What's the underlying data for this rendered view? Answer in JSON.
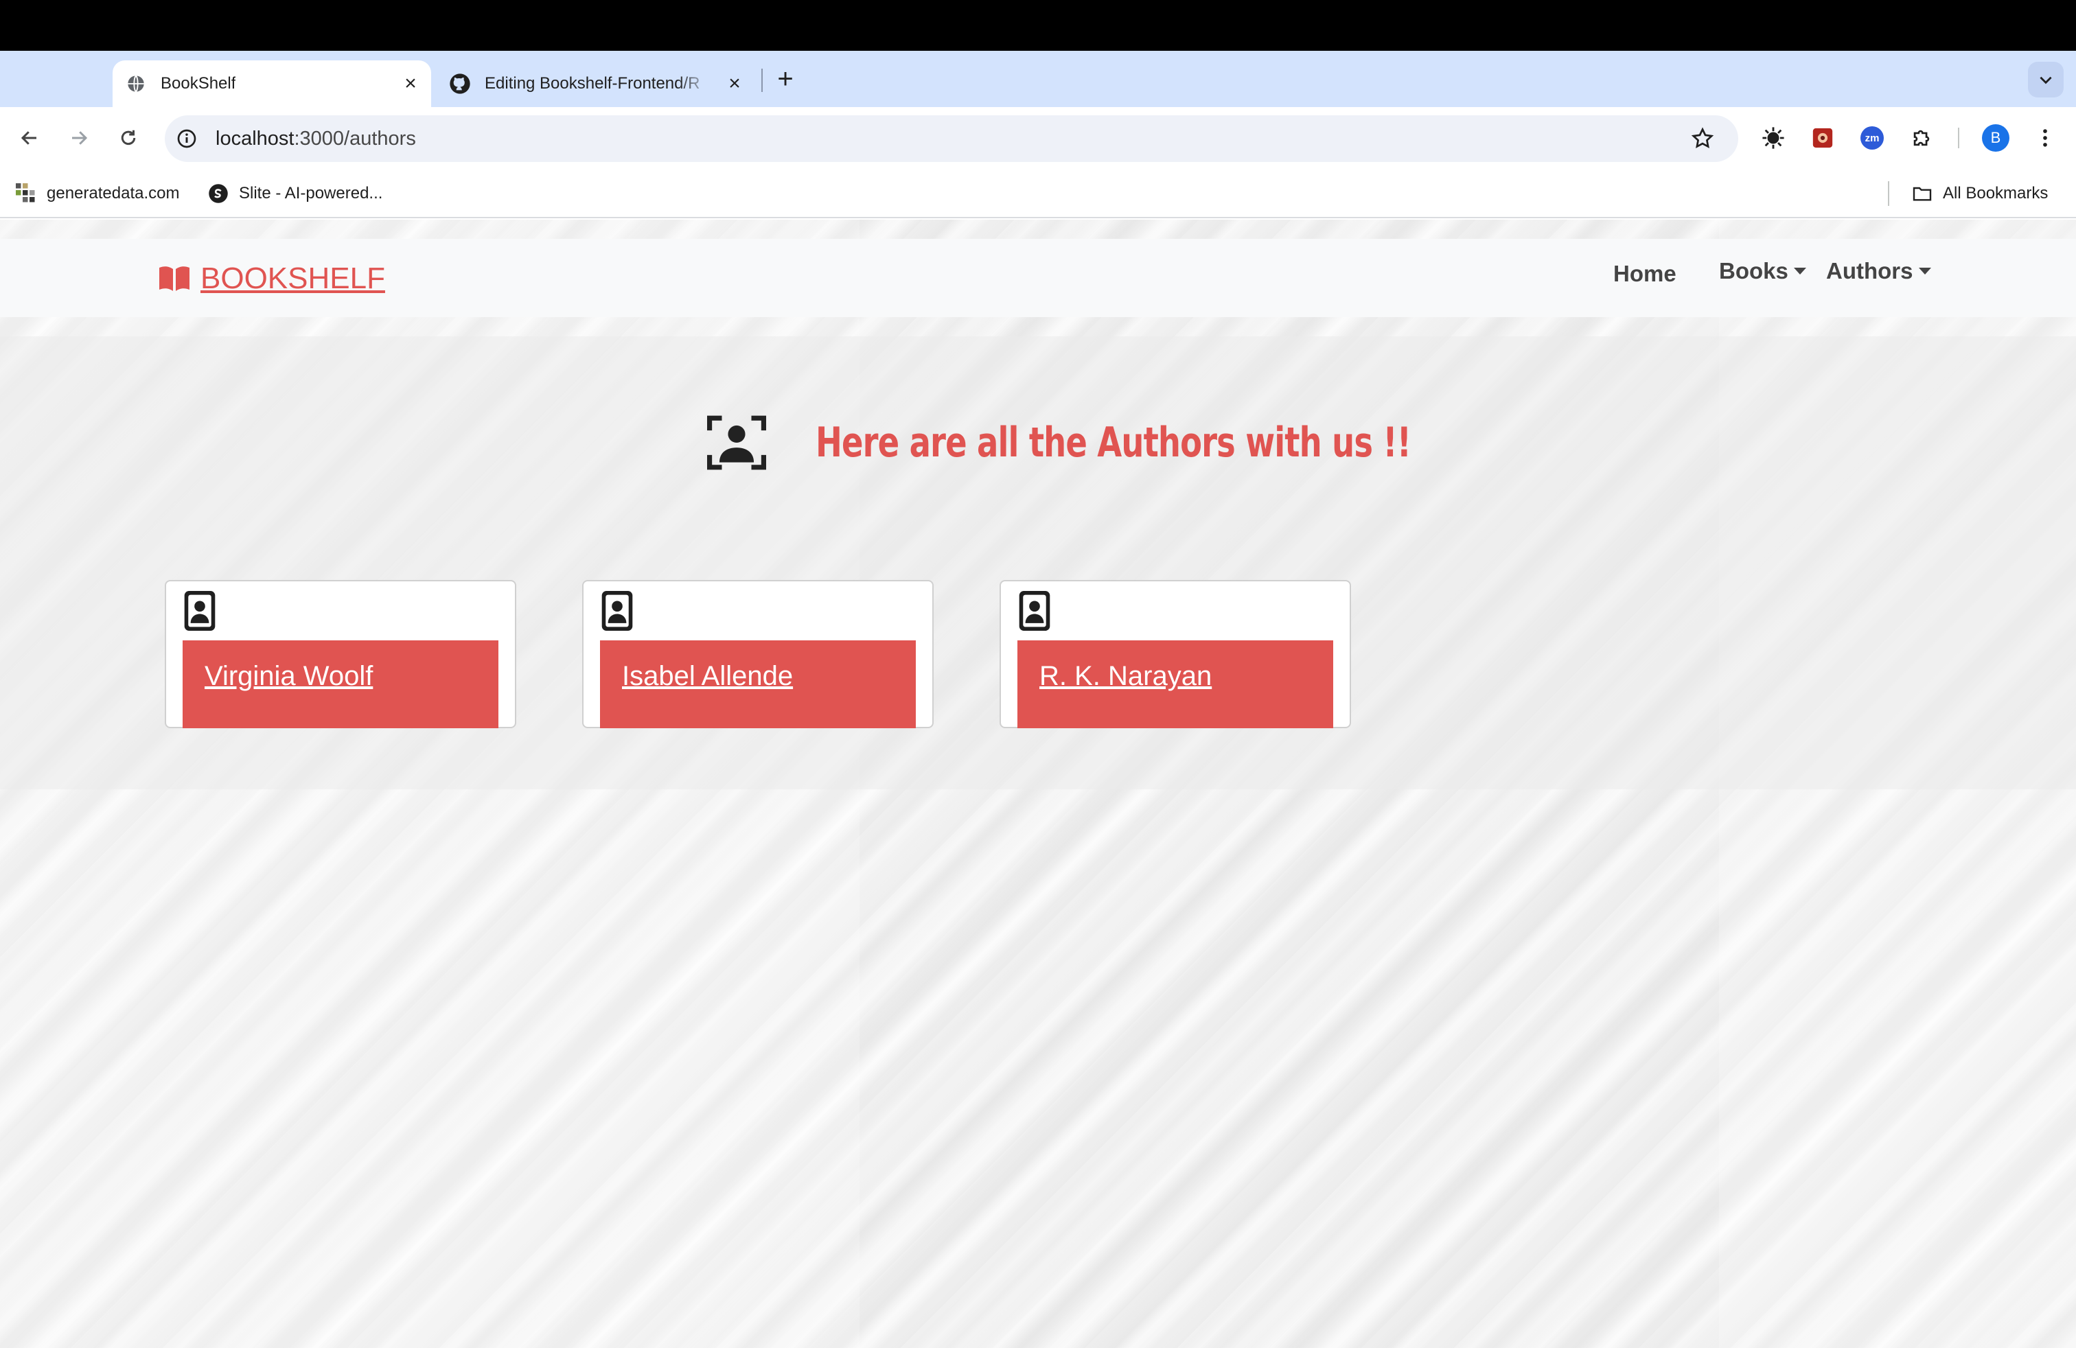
{
  "browser": {
    "tabs": [
      {
        "title": "BookShelf",
        "active": true,
        "icon": "globe-icon"
      },
      {
        "title": "Editing Bookshelf-Frontend/R",
        "active": false,
        "icon": "github-icon"
      }
    ],
    "new_tab_label": "+",
    "close_label": "×",
    "url_host": "localhost",
    "url_path": ":3000/authors",
    "bookmarks": [
      {
        "label": "generatedata.com",
        "icon": "generatedata-icon"
      },
      {
        "label": "Slite - AI-powered...",
        "icon": "slite-icon"
      }
    ],
    "all_bookmarks_label": "All Bookmarks",
    "profile_initial": "B",
    "extension_zoom_label": "zm"
  },
  "site": {
    "brand": "BOOKSHELF",
    "nav": {
      "home": "Home",
      "books": "Books",
      "authors": "Authors"
    },
    "accent_color": "#e05451"
  },
  "main": {
    "heading": "Here are all the Authors with us !!",
    "authors": [
      {
        "name": "Virginia Woolf"
      },
      {
        "name": "Isabel Allende"
      },
      {
        "name": "R. K. Narayan"
      }
    ]
  }
}
